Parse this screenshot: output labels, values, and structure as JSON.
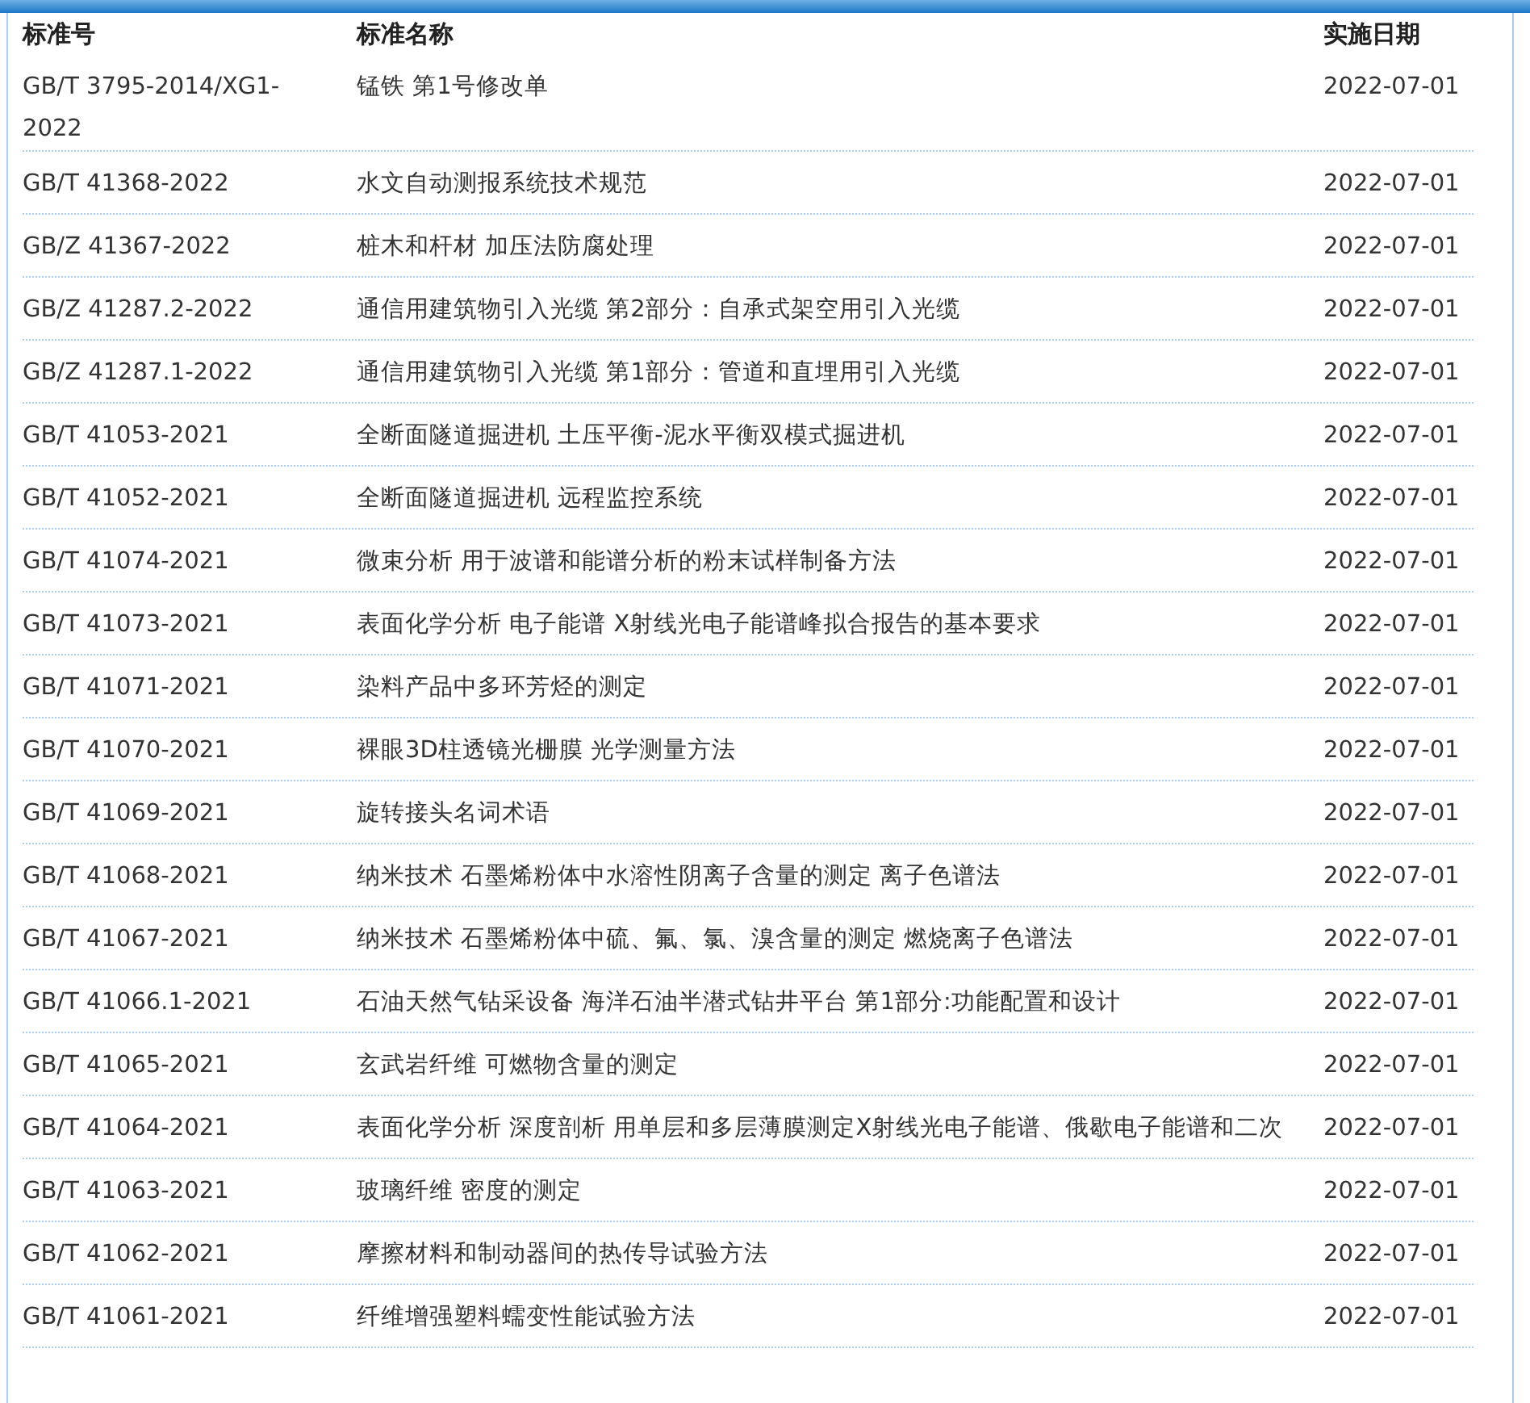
{
  "columns": [
    "标准号",
    "标准名称",
    "实施日期"
  ],
  "rows": [
    {
      "number": "GB/T 3795-2014/XG1-2022",
      "name": "锰铁 第1号修改单",
      "date": "2022-07-01"
    },
    {
      "number": "GB/T 41368-2022",
      "name": "水文自动测报系统技术规范",
      "date": "2022-07-01"
    },
    {
      "number": "GB/Z 41367-2022",
      "name": "桩木和杆材 加压法防腐处理",
      "date": "2022-07-01"
    },
    {
      "number": "GB/Z 41287.2-2022",
      "name": "通信用建筑物引入光缆 第2部分：自承式架空用引入光缆",
      "date": "2022-07-01"
    },
    {
      "number": "GB/Z 41287.1-2022",
      "name": "通信用建筑物引入光缆 第1部分：管道和直埋用引入光缆",
      "date": "2022-07-01"
    },
    {
      "number": "GB/T 41053-2021",
      "name": "全断面隧道掘进机 土压平衡-泥水平衡双模式掘进机",
      "date": "2022-07-01"
    },
    {
      "number": "GB/T 41052-2021",
      "name": "全断面隧道掘进机 远程监控系统",
      "date": "2022-07-01"
    },
    {
      "number": "GB/T 41074-2021",
      "name": "微束分析 用于波谱和能谱分析的粉末试样制备方法",
      "date": "2022-07-01"
    },
    {
      "number": "GB/T 41073-2021",
      "name": "表面化学分析 电子能谱 X射线光电子能谱峰拟合报告的基本要求",
      "date": "2022-07-01"
    },
    {
      "number": "GB/T 41071-2021",
      "name": "染料产品中多环芳烃的测定",
      "date": "2022-07-01"
    },
    {
      "number": "GB/T 41070-2021",
      "name": "裸眼3D柱透镜光栅膜 光学测量方法",
      "date": "2022-07-01"
    },
    {
      "number": "GB/T 41069-2021",
      "name": "旋转接头名词术语",
      "date": "2022-07-01"
    },
    {
      "number": "GB/T 41068-2021",
      "name": "纳米技术 石墨烯粉体中水溶性阴离子含量的测定 离子色谱法",
      "date": "2022-07-01"
    },
    {
      "number": "GB/T 41067-2021",
      "name": "纳米技术 石墨烯粉体中硫、氟、氯、溴含量的测定 燃烧离子色谱法",
      "date": "2022-07-01"
    },
    {
      "number": "GB/T 41066.1-2021",
      "name": "石油天然气钻采设备 海洋石油半潜式钻井平台 第1部分:功能配置和设计",
      "date": "2022-07-01"
    },
    {
      "number": "GB/T 41065-2021",
      "name": "玄武岩纤维 可燃物含量的测定",
      "date": "2022-07-01"
    },
    {
      "number": "GB/T 41064-2021",
      "name": "表面化学分析 深度剖析 用单层和多层薄膜测定X射线光电子能谱、俄歇电子能谱和二次",
      "date": "2022-07-01"
    },
    {
      "number": "GB/T 41063-2021",
      "name": "玻璃纤维 密度的测定",
      "date": "2022-07-01"
    },
    {
      "number": "GB/T 41062-2021",
      "name": "摩擦材料和制动器间的热传导试验方法",
      "date": "2022-07-01"
    },
    {
      "number": "GB/T 41061-2021",
      "name": "纤维增强塑料蠕变性能试验方法",
      "date": "2022-07-01"
    }
  ]
}
